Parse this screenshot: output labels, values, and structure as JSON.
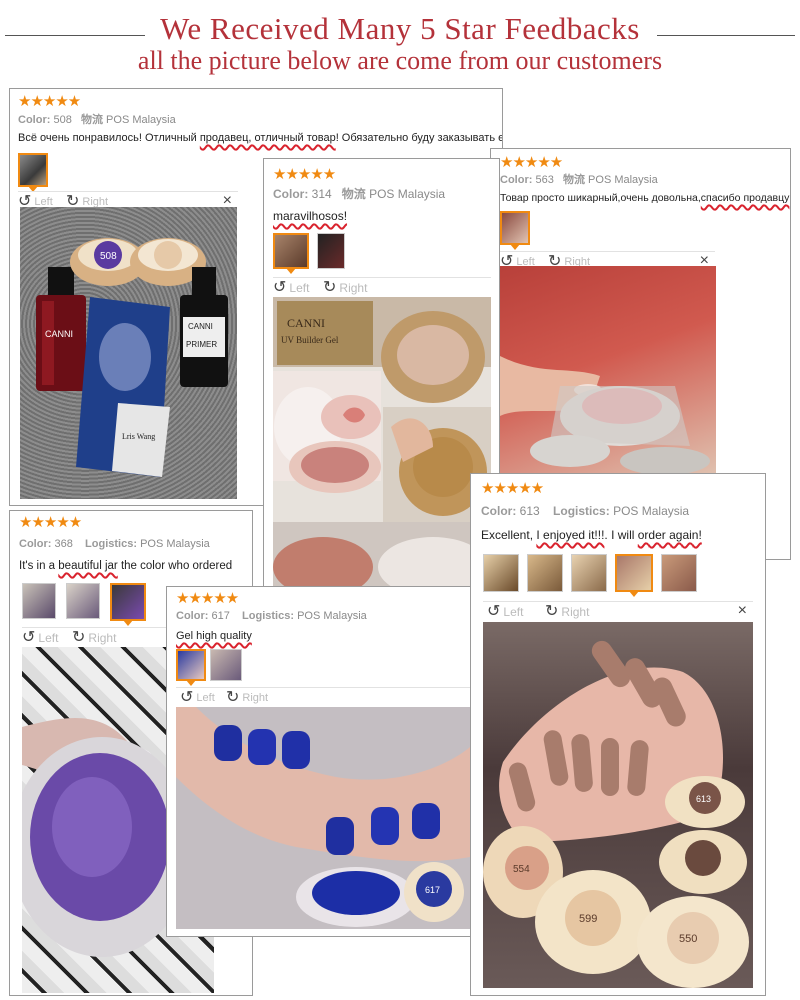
{
  "header": {
    "title": "We Received Many 5 Star Feedbacks",
    "subtitle": "all the picture below are come from our customers"
  },
  "labels": {
    "stars": "★★★★★",
    "left": "Left",
    "right": "Right",
    "close": "×"
  },
  "cards": [
    {
      "color_label": "Color:",
      "color": "508",
      "logistics_label": "物流",
      "logistics": "POS Malaysia",
      "review_a": "Всё очень понравилось! Отличный ",
      "review_b": "продавец, отличный товар",
      "review_c": "! Обязательно буду заказывать ещё))"
    },
    {
      "color_label": "Color:",
      "color": "314",
      "logistics_label": "物流",
      "logistics": "POS Malaysia",
      "review_a": "",
      "review_b": "maravilhosos!",
      "review_c": ""
    },
    {
      "color_label": "Color:",
      "color": "563",
      "logistics_label": "物流",
      "logistics": "POS Malaysia",
      "review_a": "Товар просто шикарный,очень довольна,",
      "review_b": "спасибо продавцу",
      "review_c": ""
    },
    {
      "color_label": "Color:",
      "color": "368",
      "logistics_label": "Logistics:",
      "logistics": "POS Malaysia",
      "review_a": "It's in a ",
      "review_b": "beautiful jar",
      "review_c": " the color who ordered"
    },
    {
      "color_label": "Color:",
      "color": "617",
      "logistics_label": "Logistics:",
      "logistics": "POS Malaysia",
      "review_a": "",
      "review_b": "Gel high quality",
      "review_c": ""
    },
    {
      "color_label": "Color:",
      "color": "613",
      "logistics_label": "Logistics:",
      "logistics": "POS Malaysia",
      "review_a": "Excellent, ",
      "review_b": "I enjoyed it!!!",
      "review_c": ". I will ",
      "review_d": "order again!"
    }
  ],
  "photo_text": {
    "canni": "CANNI",
    "primer": "PRIMER",
    "card_name": "Lris Wang",
    "builder": "UV Builder Gel",
    "jar_508": "508",
    "jar_617": "617",
    "jar_613": "613",
    "jar_554": "554",
    "jar_599": "599",
    "jar_550": "550"
  },
  "colors": {
    "accent": "#b4323a",
    "stars": "#f08a12",
    "underline": "#d9232e"
  },
  "icons": [
    "rotate-left-icon",
    "rotate-right-icon",
    "close-icon",
    "star-icon"
  ]
}
